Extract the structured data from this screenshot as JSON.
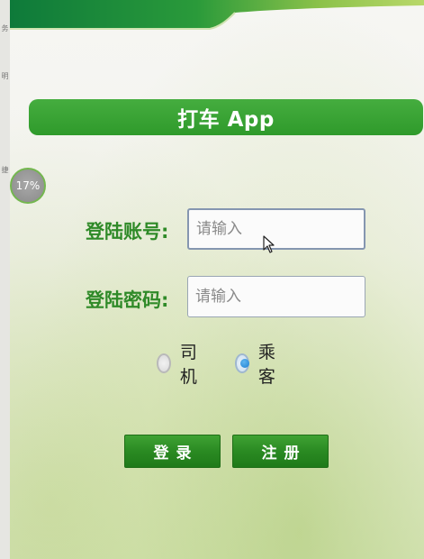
{
  "side_strip": {
    "chars": [
      "务",
      "明",
      "捷"
    ]
  },
  "header": {
    "title": "打车 App"
  },
  "progress_badge": {
    "text": "17%"
  },
  "form": {
    "account_label": "登陆账号:",
    "account_placeholder": "请输入",
    "account_value": "",
    "password_label": "登陆密码:",
    "password_placeholder": "请输入",
    "password_value": "",
    "role_options": [
      {
        "label": "司机",
        "checked": false
      },
      {
        "label": "乘客",
        "checked": true
      }
    ]
  },
  "buttons": {
    "login_label": "登录",
    "register_label": "注册"
  },
  "colors": {
    "brand_green": "#2f9a2b",
    "label_green": "#2f8a28",
    "radio_selected": "#1f7fd0"
  },
  "icons": {
    "cursor": "mouse-pointer-icon"
  }
}
